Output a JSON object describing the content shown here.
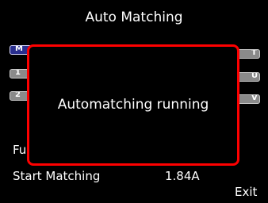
{
  "screen": {
    "title": "Auto Matching"
  },
  "left_buttons": [
    {
      "label": "M",
      "selected": true
    },
    {
      "label": "1",
      "selected": false
    },
    {
      "label": "2",
      "selected": false
    }
  ],
  "right_buttons": [
    {
      "label": "T"
    },
    {
      "label": "U"
    },
    {
      "label": "V"
    }
  ],
  "menu": {
    "function_label": "Fu",
    "start_label": "Start Matching",
    "current_value": "1.84A"
  },
  "softkey": {
    "exit_label": "Exit"
  },
  "modal": {
    "message": "Automatching running"
  },
  "colors": {
    "background": "#000000",
    "text": "#ffffff",
    "modal_border": "#ff0000",
    "selected_button": "#2a2f8f",
    "button": "#8a8a8a"
  }
}
